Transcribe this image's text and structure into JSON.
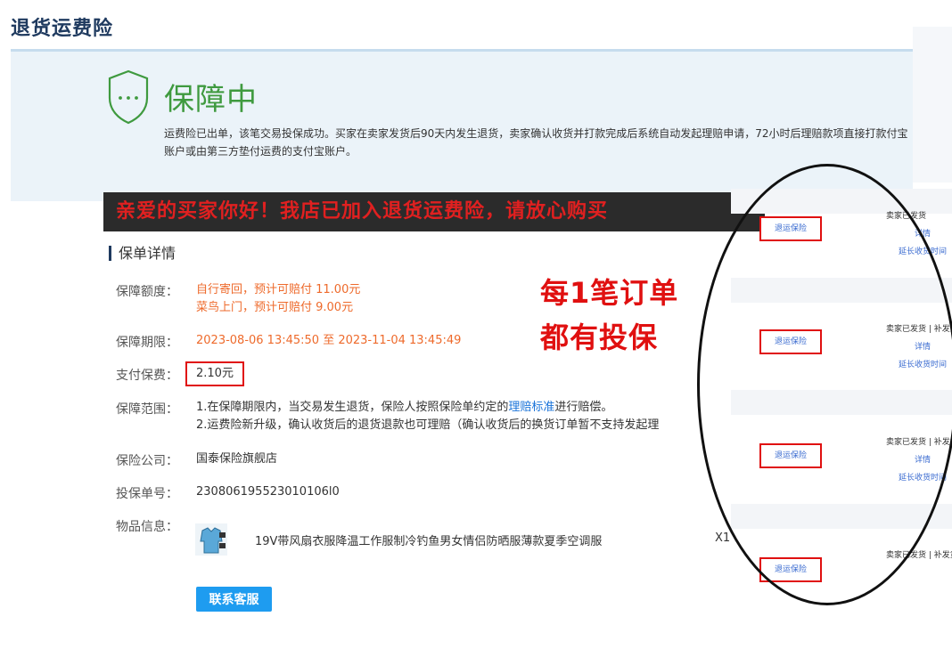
{
  "page": {
    "title": "退货运费险"
  },
  "status": {
    "title": "保障中",
    "description": "运费险已出单，该笔交易投保成功。买家在卖家发货后90天内发生退货，卖家确认收货并打款完成后系统自动发起理赔申请，72小时后理赔款项直接打款付宝账户或由第三方垫付运费的支付宝账户。"
  },
  "banner": {
    "text": "亲爱的买家你好！我店已加入退货运费险，请放心购买"
  },
  "policy": {
    "section_title": "保单详情",
    "coverage_amount": {
      "label": "保障额度：",
      "line1": "自行寄回，预计可赔付 11.00元",
      "line2": "菜鸟上门，预计可赔付 9.00元"
    },
    "coverage_period": {
      "label": "保障期限：",
      "value": "2023-08-06 13:45:50 至 2023-11-04 13:45:49"
    },
    "premium": {
      "label": "支付保费：",
      "value": "2.10元"
    },
    "scope": {
      "label": "保障范围：",
      "line1_pre": "1.在保障期限内，当交易发生退货，保险人按照保险单约定的",
      "line1_link": "理赔标准",
      "line1_post": "进行赔偿。",
      "line2": "2.运费险新升级，确认收货后的退货退款也可理赔（确认收货后的换货订单暂不支持发起理"
    },
    "insurer": {
      "label": "保险公司：",
      "value": "国泰保险旗舰店"
    },
    "policy_number": {
      "label": "投保单号：",
      "value": "230806195523010106l0"
    },
    "item": {
      "label": "物品信息：",
      "name": "19V带风扇衣服降温工作服制冷钓鱼男女情侣防晒服薄款夏季空调服",
      "qty": "X1"
    },
    "contact_button": "联系客服"
  },
  "callout": {
    "line1": "每1笔订单",
    "line2": "都有投保"
  },
  "orders": [
    {
      "tag": "退运保险",
      "status": "卖家已发货",
      "detail": "详情",
      "extend": "延长收货时间"
    },
    {
      "tag": "退运保险",
      "status": "卖家已发货 | 补发货",
      "detail": "详情",
      "extend": "延长收货时间"
    },
    {
      "tag": "退运保险",
      "status": "卖家已发货 | 补发货",
      "detail": "详情",
      "extend": "延长收货时间"
    },
    {
      "tag": "退运保险",
      "status": "卖家已发货 | 补发货"
    }
  ],
  "colors": {
    "status_green": "#3f9a3f",
    "accent_orange": "#ee6a2b",
    "highlight_red": "#e01010",
    "button_blue": "#1e9cf0"
  },
  "icons": {
    "status": "shield-icon"
  }
}
